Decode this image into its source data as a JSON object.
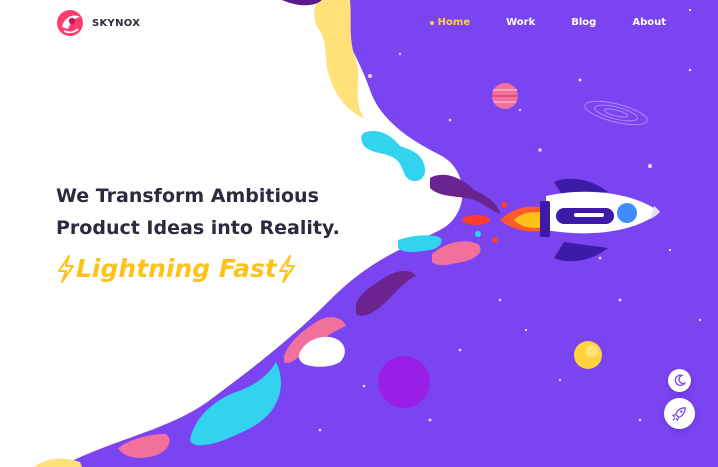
{
  "brand": {
    "name": "SKYNOX",
    "logo_icon": "skynox-logo-icon"
  },
  "nav": {
    "items": [
      {
        "label": "Home",
        "active": true
      },
      {
        "label": "Work",
        "active": false
      },
      {
        "label": "Blog",
        "active": false
      },
      {
        "label": "About",
        "active": false
      }
    ]
  },
  "hero": {
    "line1": "We Transform Ambitious",
    "line2": "Product Ideas into Reality.",
    "tagline": "Lightning Fast",
    "tag_icon": "lightning-bolt-icon"
  },
  "controls": {
    "theme_toggle_icon": "moon-icon",
    "launch_icon": "rocket-icon"
  },
  "colors": {
    "space": "#7a44f0",
    "accent_yellow": "#ffd23f",
    "tagline": "#ffc21a",
    "heading": "#2d2a3e"
  }
}
